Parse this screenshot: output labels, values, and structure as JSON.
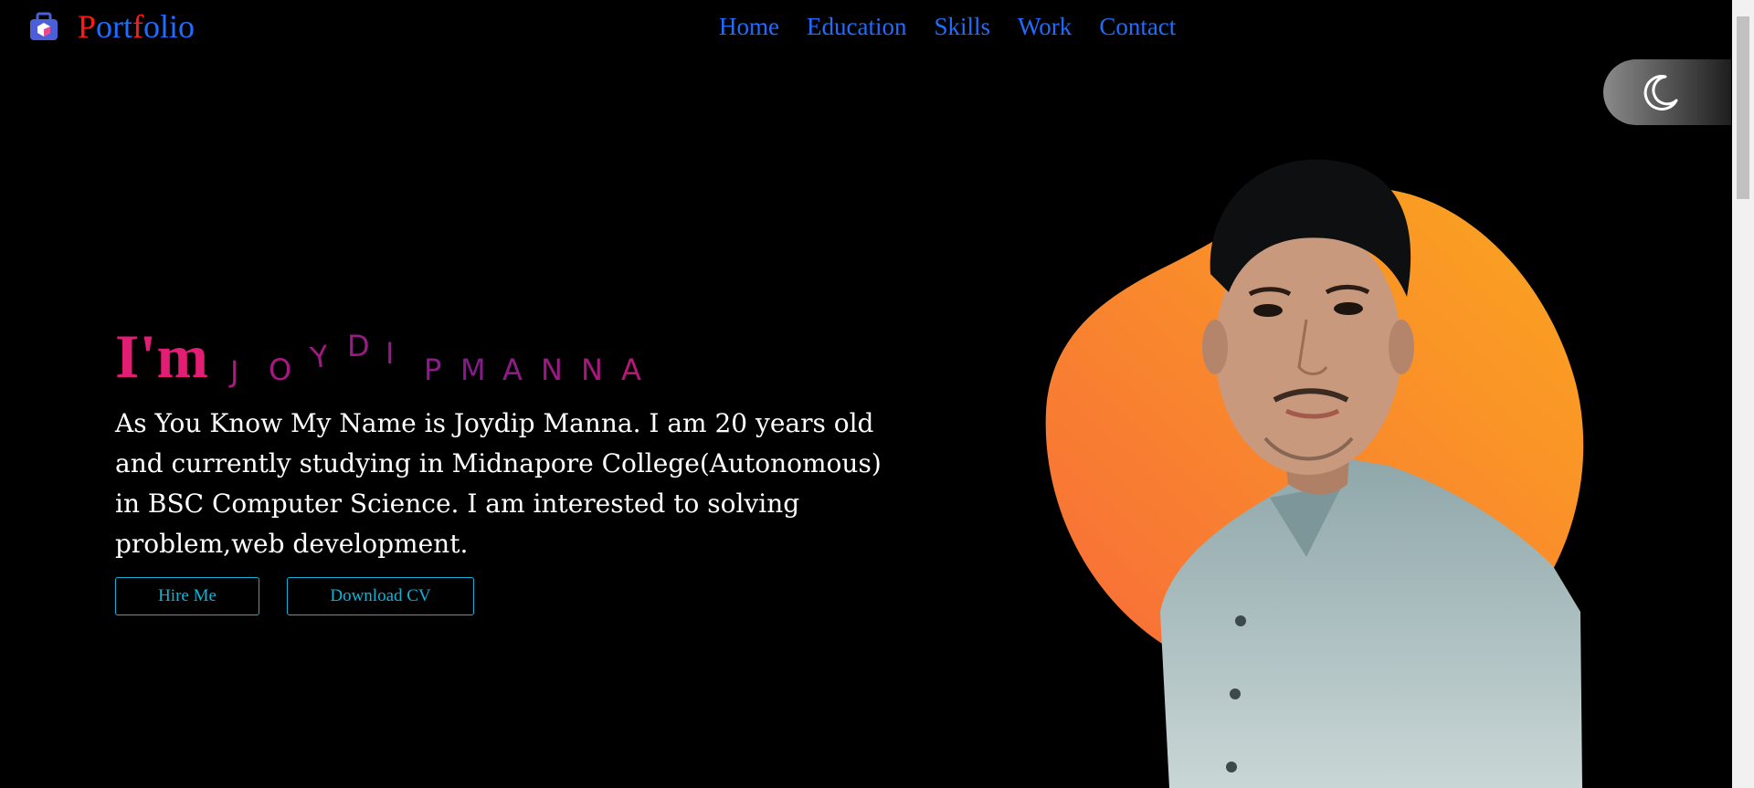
{
  "logo": {
    "p": "P",
    "ort": "ort",
    "f": "f",
    "olio": "olio"
  },
  "nav": {
    "items": [
      "Home",
      "Education",
      "Skills",
      "Work",
      "Contact"
    ]
  },
  "hero": {
    "prefix": "I'm",
    "name_letters": [
      "J",
      "O",
      "Y",
      "D",
      "I",
      "P",
      "M",
      "A",
      "N",
      "N",
      "A"
    ],
    "bio": "As You Know My Name is Joydip Manna. I am 20 years old and currently studying in Midnapore College(Autonomous) in BSC Computer Science. I am interested to solving problem,web development.",
    "hire_label": "Hire Me",
    "cv_label": "Download CV"
  },
  "icons": {
    "logo": "briefcase-icon",
    "toggle": "moon-icon"
  },
  "colors": {
    "accent_blue": "#1f6cff",
    "accent_red": "#ff1a1a",
    "pink": "#e11d74",
    "cyan": "#10b3d8",
    "blob": "#f98a2a"
  }
}
